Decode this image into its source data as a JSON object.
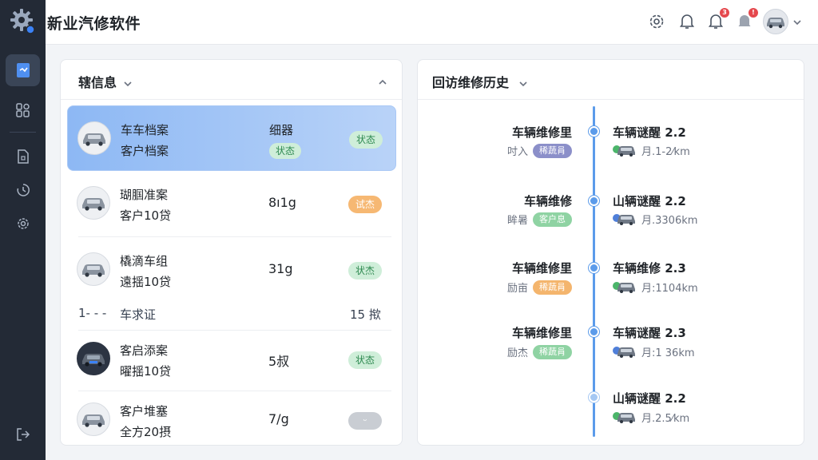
{
  "app": {
    "title": "新业汽修软件"
  },
  "topbar": {
    "notif_badge_1": "3",
    "notif_badge_2": "!"
  },
  "left_panel": {
    "title": "辖信息",
    "rows": [
      {
        "line1": "车车档案",
        "line2": "客户档案",
        "mid": "细器",
        "mid_tag": "状态",
        "tag": "状态",
        "tag_color": "green"
      },
      {
        "line1": "瑚腘准案",
        "line2": "客户10贷",
        "mid": "8ı1g",
        "tag": "试杰",
        "tag_color": "orange"
      },
      {
        "line1": "橇滴车组",
        "line2": "遠揺10贷",
        "mid": "31g",
        "tag": "状杰",
        "tag_color": "green"
      },
      {
        "line1": "客启添案",
        "line2": "曜揺10贷",
        "mid": "5叔",
        "tag": "状态",
        "tag_color": "green"
      },
      {
        "line1": "客户堆塞",
        "line2": "全方20摂",
        "mid": "7/g",
        "tag": "ᵕ",
        "tag_color": "gray"
      }
    ],
    "plain_row": {
      "col1": "1- - -",
      "col2": "车求证",
      "col3": "15 揿"
    }
  },
  "right_panel": {
    "title": "回访维修历史",
    "timeline": [
      {
        "left_title": "车辆维修里",
        "left_sub": "吋入",
        "left_tag": "稀蔬肙",
        "left_tag_color": "purple",
        "right_title": "车辆谜醒 2.2",
        "right_sub": "月.1-2⁄km",
        "chip": "#4bb56a"
      },
      {
        "left_title": "车辆维修",
        "left_sub": "眸暑",
        "left_tag": "客户息",
        "left_tag_color": "green",
        "right_title": "山辆谜醒 2.2",
        "right_sub": "月.3306km",
        "chip": "#4f7fd9"
      },
      {
        "left_title": "车辆维修里",
        "left_sub": "励亩",
        "left_tag": "稀蔬肙",
        "left_tag_color": "orange",
        "right_title": "车辆维修 2.3",
        "right_sub": "月:1104km",
        "chip": "#4bb56a"
      },
      {
        "left_title": "车辆维修里",
        "left_sub": "励杰",
        "left_tag": "稀蔬肙",
        "left_tag_color": "green",
        "right_title": "车辆谜醒 2.3",
        "right_sub": "月:1 36km",
        "chip": "#4f7fd9"
      },
      {
        "left_title": "",
        "left_sub": "",
        "left_tag": "",
        "left_tag_color": "",
        "right_title": "山辆谜醒 2.2",
        "right_sub": "月.2.5⁄km",
        "chip": "#4bb56a"
      }
    ]
  },
  "colors": {
    "accent": "#5b9bea",
    "sidebar": "#232a36",
    "selected_row": "#8db8f4"
  },
  "icons": [
    "gear-logo-icon",
    "document-icon",
    "grid-icon",
    "file-icon",
    "history-icon",
    "settings-icon",
    "logout-icon",
    "help-gear-icon",
    "bell-icon",
    "chevron-down-icon",
    "chevron-up-icon",
    "car-icon"
  ]
}
